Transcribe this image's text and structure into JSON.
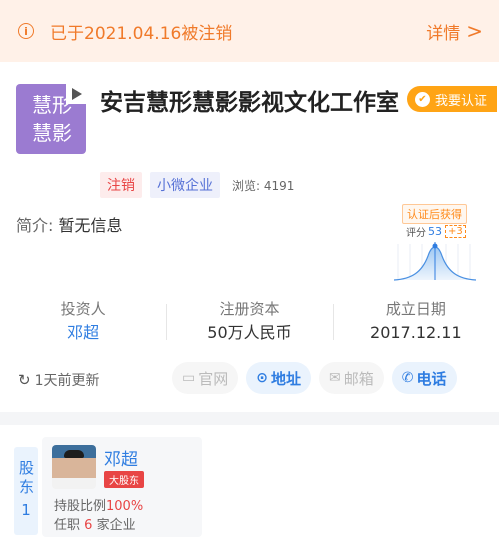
{
  "banner": {
    "status_text": "已于2021.04.16被注销",
    "detail_label": "详情",
    "detail_chevron": ">",
    "info_icon": "i",
    "bg_color": "#fff1e8",
    "text_color": "#f07a2a"
  },
  "company": {
    "logo_line1": "慧形",
    "logo_line2": "慧影",
    "name": "安吉慧形慧影影视文化工作室",
    "certify_label": "我要认证",
    "tags": [
      "注销",
      "小微企业"
    ],
    "views_label": "浏览:",
    "views_count": "4191",
    "intro_label": "简介:",
    "intro_value": "暂无信息",
    "cert": {
      "title": "认证后获得",
      "score_label": "评分",
      "score_value": "53",
      "score_plus": "+3"
    }
  },
  "stats": [
    {
      "key": "投资人",
      "value": "邓超"
    },
    {
      "key": "注册资本",
      "value": "50万人民币"
    },
    {
      "key": "成立日期",
      "value": "2017.12.11"
    }
  ],
  "update_text": "1天前更新",
  "actions": [
    {
      "label": "官网",
      "icon": "monitor-icon",
      "enabled": false
    },
    {
      "label": "地址",
      "icon": "location-pin-icon",
      "enabled": true
    },
    {
      "label": "邮箱",
      "icon": "mail-icon",
      "enabled": false
    },
    {
      "label": "电话",
      "icon": "phone-icon",
      "enabled": true
    }
  ],
  "shareholders": {
    "section_label": "股东",
    "count": "1",
    "items": [
      {
        "name": "邓超",
        "badge": "大股东",
        "ratio_label": "持股比例",
        "ratio_value": "100%",
        "posts_prefix": "任职",
        "posts_count": "6",
        "posts_suffix": "家企业"
      }
    ]
  }
}
